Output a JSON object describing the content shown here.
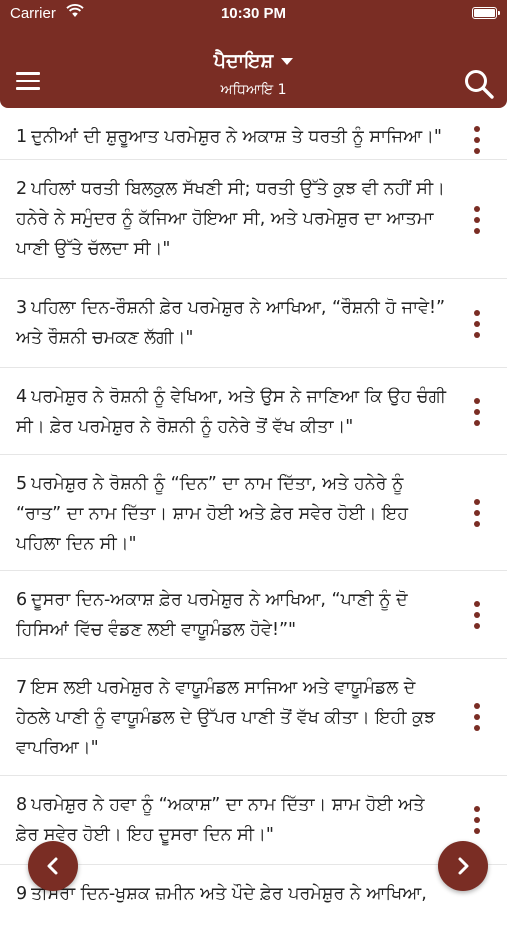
{
  "status_bar": {
    "carrier": "Carrier",
    "time": "10:30 PM"
  },
  "header": {
    "book": "ਪੈਦਾਇਸ਼",
    "chapter": "ਅਧਿਆਇ 1"
  },
  "verses": [
    {
      "num": "1",
      "text": "ਦੁਨੀਆਂ ਦੀ ਸ਼ੁਰੂਆਤ ਪਰਮੇਸ਼ੁਰ ਨੇ ਅਕਾਸ਼ ਤੇ ਧਰਤੀ ਨੂੰ ਸਾਜਿਆ।\""
    },
    {
      "num": "2",
      "text": "ਪਹਿਲਾਂ ਧਰਤੀ ਬਿਲਕੁਲ ਸੱਖਣੀ ਸੀ; ਧਰਤੀ ਉੱਤੇ ਕੁਝ ਵੀ ਨਹੀਂ ਸੀ। ਹਨੇਰੇ ਨੇ ਸਮੁੰਦਰ ਨੂੰ ਕੱਜਿਆ ਹੋਇਆ ਸੀ, ਅਤੇ ਪਰਮੇਸ਼ੁਰ ਦਾ ਆਤਮਾ ਪਾਣੀ ਉੱਤੇ ਚੱਲਦਾ ਸੀ।\""
    },
    {
      "num": "3",
      "text": "ਪਹਿਲਾ ਦਿਨ-ਰੌਸ਼ਨੀ ਫ਼ੇਰ ਪਰਮੇਸ਼ੁਰ ਨੇ ਆਖਿਆ, “ਰੌਸ਼ਨੀ ਹੋ ਜਾਵੇ!” ਅਤੇ ਰੌਸ਼ਨੀ ਚਮਕਣ ਲੱਗੀ।\""
    },
    {
      "num": "4",
      "text": "ਪਰਮੇਸ਼ੁਰ ਨੇ ਰੋਸ਼ਨੀ ਨੂੰ ਵੇਖਿਆ, ਅਤੇ ਉਸ ਨੇ ਜਾਣਿਆ ਕਿ ਉਹ ਚੰਗੀ ਸੀ। ਫ਼ੇਰ ਪਰਮੇਸ਼ੁਰ ਨੇ ਰੋਸ਼ਨੀ ਨੂੰ ਹਨੇਰੇ ਤੋਂ ਵੱਖ ਕੀਤਾ।\""
    },
    {
      "num": "5",
      "text": "ਪਰਮੇਸ਼ੁਰ ਨੇ ਰੋਸ਼ਨੀ ਨੂੰ “ਦਿਨ” ਦਾ ਨਾਮ ਦਿੱਤਾ, ਅਤੇ ਹਨੇਰੇ ਨੂੰ “ਰਾਤ” ਦਾ ਨਾਮ ਦਿੱਤਾ। ਸ਼ਾਮ ਹੋਈ ਅਤੇ ਫ਼ੇਰ ਸਵੇਰ ਹੋਈ। ਇਹ ਪਹਿਲਾ ਦਿਨ ਸੀ।\""
    },
    {
      "num": "6",
      "text": "ਦੂਸਰਾ ਦਿਨ-ਅਕਾਸ਼ ਫ਼ੇਰ ਪਰਮੇਸ਼ੁਰ ਨੇ ਆਖਿਆ, “ਪਾਣੀ ਨੂੰ ਦੋ ਹਿਸਿਆਂ ਵਿੱਚ ਵੰਡਣ ਲਈ ਵਾਯੂਮੰਡਲ ਹੋਵੇ!”\""
    },
    {
      "num": "7",
      "text": "ਇਸ ਲਈ ਪਰਮੇਸ਼ੁਰ ਨੇ ਵਾਯੂਮੰਡਲ ਸਾਜਿਆ ਅਤੇ ਵਾਯੂਮੰਡਲ ਦੇ ਹੇਠਲੇ ਪਾਣੀ ਨੂੰ ਵਾਯੂਮੰਡਲ ਦੇ ਉੱਪਰ ਪਾਣੀ ਤੋਂ ਵੱਖ ਕੀਤਾ। ਇਹੀ ਕੁਝ ਵਾਪਰਿਆ।\""
    },
    {
      "num": "8",
      "text": "ਪਰਮੇਸ਼ੁਰ ਨੇ ਹਵਾ ਨੂੰ “ਅਕਾਸ਼” ਦਾ ਨਾਮ ਦਿੱਤਾ। ਸ਼ਾਮ ਹੋਈ ਅਤੇ ਫ਼ੇਰ ਸਵੇਰ ਹੋਈ। ਇਹ ਦੂਸਰਾ ਦਿਨ ਸੀ।\""
    },
    {
      "num": "9",
      "text": "ਤੀਸਰਾ ਦਿਨ-ਖੁਸ਼ਕ ਜ਼ਮੀਨ ਅਤੇ ਪੌਦੇ ਫ਼ੇਰ ਪਰਮੇਸ਼ੁਰ ਨੇ ਆਖਿਆ,"
    }
  ],
  "colors": {
    "primary": "#7a2d24"
  },
  "icons": {
    "menu": "hamburger-icon",
    "search": "search-icon",
    "more": "vertical-dots-icon",
    "prev": "chevron-left-icon",
    "next": "chevron-right-icon"
  }
}
